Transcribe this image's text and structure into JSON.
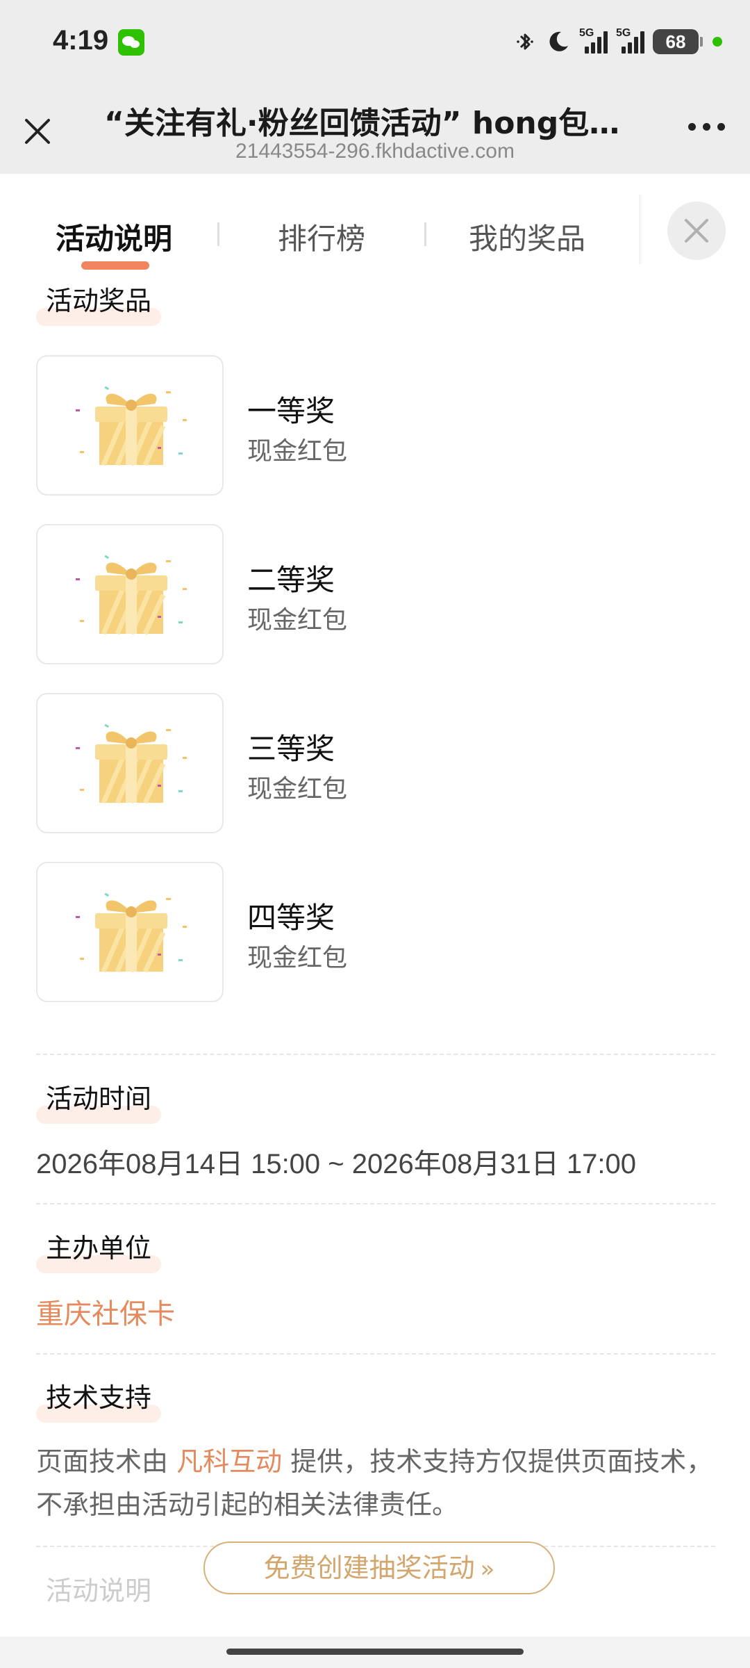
{
  "status_bar": {
    "time": "4:19",
    "battery": "68",
    "signal1_label": "5G",
    "signal2_label": "5G",
    "icons": [
      "wechat-icon",
      "bluetooth-icon",
      "moon-icon",
      "signal-icon",
      "battery-icon"
    ]
  },
  "nav": {
    "title": "“关注有礼·粉丝回馈活动” hong包等...",
    "url": "21443554-296.fkhdactive.com"
  },
  "tabs": [
    {
      "label": "活动说明",
      "active": true
    },
    {
      "label": "排行榜",
      "active": false
    },
    {
      "label": "我的奖品",
      "active": false
    }
  ],
  "sections": {
    "prizes_title": "活动奖品",
    "time_title": "活动时间",
    "organizer_title": "主办单位",
    "support_title": "技术支持"
  },
  "prizes": [
    {
      "name": "一等奖",
      "desc": "现金红包"
    },
    {
      "name": "二等奖",
      "desc": "现金红包"
    },
    {
      "name": "三等奖",
      "desc": "现金红包"
    },
    {
      "name": "四等奖",
      "desc": "现金红包"
    }
  ],
  "activity_time": "2026年08月14日 15:00 ~ 2026年08月31日 17:00",
  "organizer": "重庆社保卡",
  "support": {
    "prefix": "页面技术由 ",
    "link": "凡科互动",
    "suffix": " 提供，技术支持方仅提供页面技术，不承担由活动引起的相关法律责任。"
  },
  "create_button": "免费创建抽奖活动",
  "faded_next_section": "活动说明",
  "colors": {
    "accent": "#f08560",
    "link": "#e58a5d",
    "button_border": "#d7b07a",
    "button_text": "#d2a66c"
  }
}
